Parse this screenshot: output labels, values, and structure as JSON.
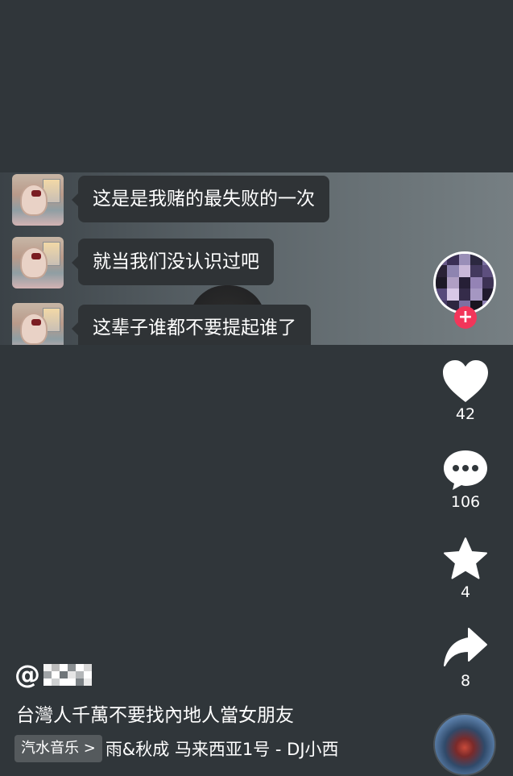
{
  "chat_messages": [
    {
      "text": "这是是我赌的最失败的一次"
    },
    {
      "text": "就当我们没认识过吧"
    },
    {
      "text": "这辈子谁都不要提起谁了"
    }
  ],
  "actions": {
    "follow_label": "+",
    "like_count": "42",
    "comment_count": "106",
    "favorite_count": "4",
    "share_count": "8"
  },
  "video_info": {
    "author_prefix": "@",
    "caption": "台灣人千萬不要找內地人當女朋友",
    "music_tag": "汽水音乐 >",
    "music_title": "雨&秋成  马来西亚1号 - DJ小西"
  },
  "colors": {
    "background": "#30363a",
    "follow_accent": "#f2365a",
    "icon": "#ffffff"
  }
}
